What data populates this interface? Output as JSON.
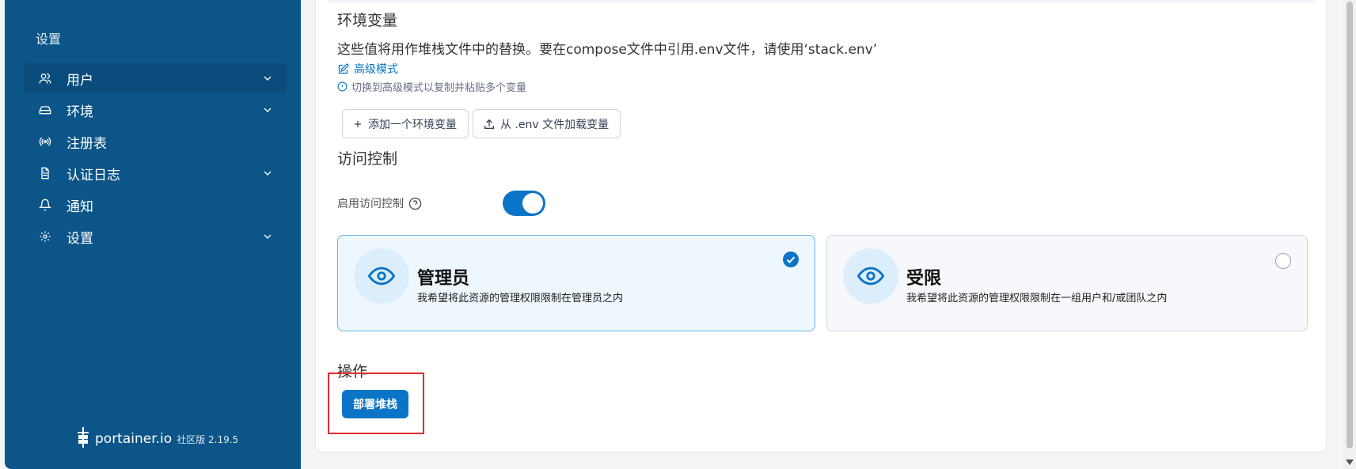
{
  "sidebar": {
    "title": "设置",
    "items": [
      {
        "label": "用户",
        "icon": "users-icon",
        "has_chevron": true
      },
      {
        "label": "环境",
        "icon": "hard-drive-icon",
        "has_chevron": true
      },
      {
        "label": "注册表",
        "icon": "radio-icon",
        "has_chevron": false
      },
      {
        "label": "认证日志",
        "icon": "file-text-icon",
        "has_chevron": true
      },
      {
        "label": "通知",
        "icon": "bell-icon",
        "has_chevron": false
      },
      {
        "label": "设置",
        "icon": "gear-icon",
        "has_chevron": true
      }
    ],
    "brand": {
      "name": "portainer.io",
      "edition": "社区版 2.19.5"
    }
  },
  "env_vars": {
    "title": "环境变量",
    "description": "这些值将用作堆栈文件中的替换。要在compose文件中引用.env文件，请使用‘stack.env’",
    "advanced_mode_link": "高级模式",
    "hint": "切换到高级模式以复制并粘贴多个变量",
    "add_button": "添加一个环境变量",
    "load_button": "从 .env 文件加载变量"
  },
  "access_control": {
    "title": "访问控制",
    "toggle_label": "启用访问控制",
    "toggle_on": true,
    "options": [
      {
        "title": "管理员",
        "description": "我希望将此资源的管理权限限制在管理员之内",
        "selected": true
      },
      {
        "title": "受限",
        "description": "我希望将此资源的管理权限限制在一组用户和/或团队之内",
        "selected": false
      }
    ]
  },
  "actions": {
    "title": "操作",
    "deploy_button": "部署堆栈"
  },
  "colors": {
    "sidebar_bg": "#0b5588",
    "primary": "#0b74c6",
    "highlight_box": "#e02d2d"
  }
}
